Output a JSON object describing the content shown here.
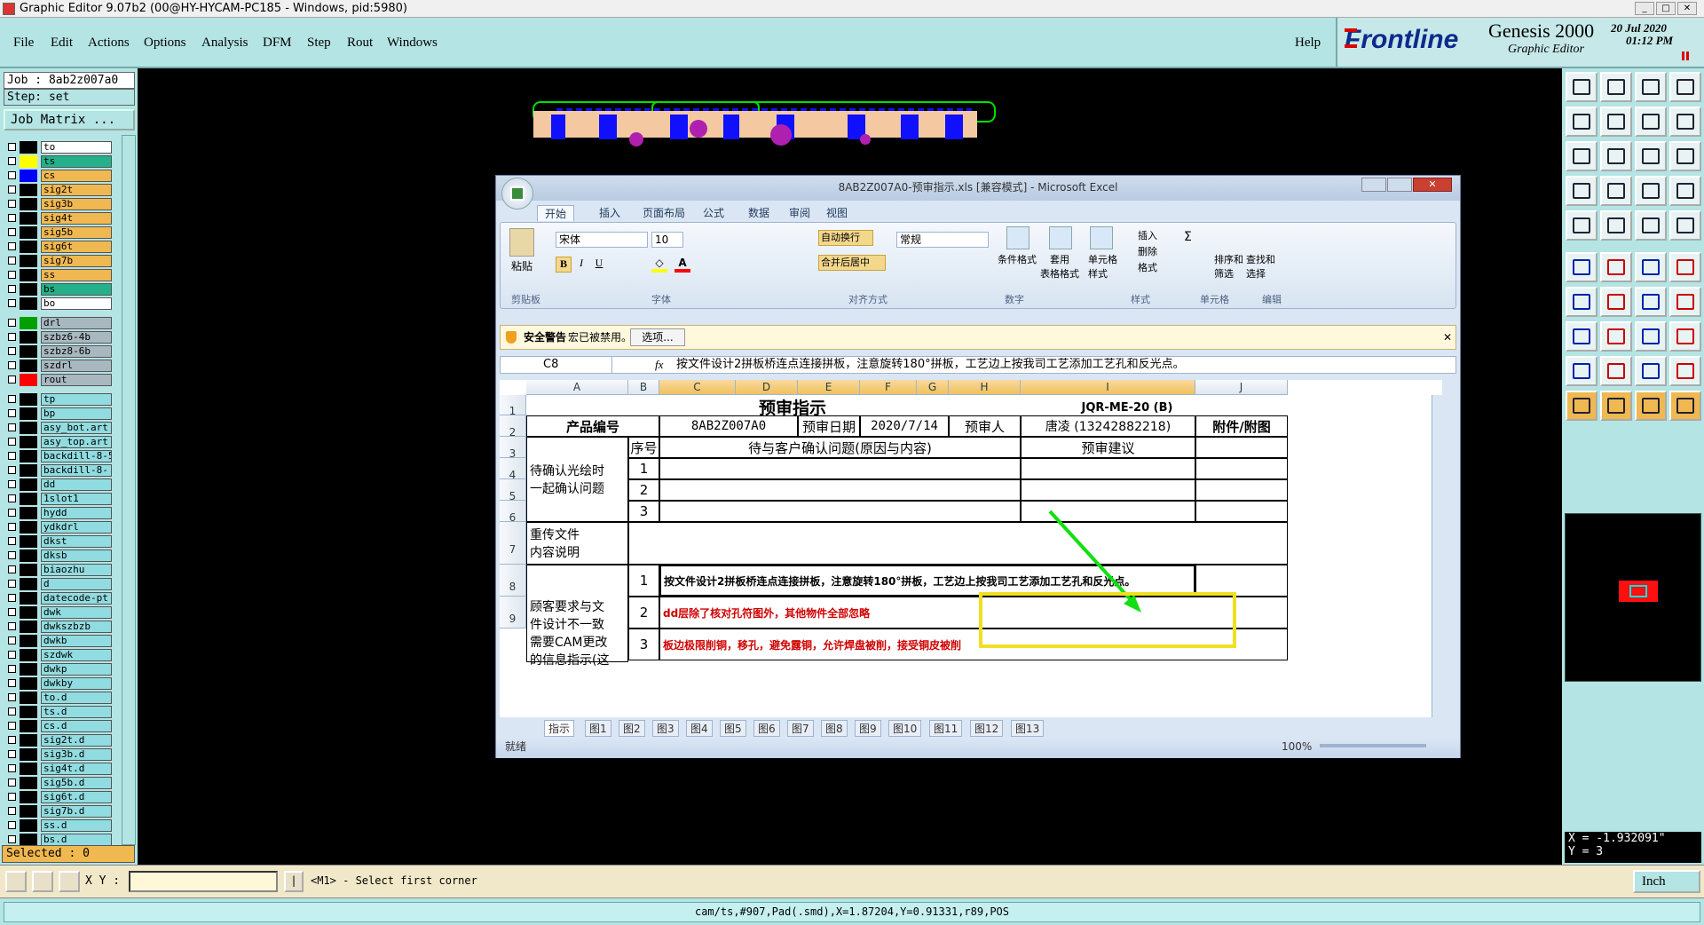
{
  "app": {
    "title": "Graphic Editor 9.07b2 (00@HY-HYCAM-PC185 - Windows, pid:5980)",
    "menu": [
      "File",
      "Edit",
      "Actions",
      "Options",
      "Analysis",
      "DFM",
      "Step",
      "Rout",
      "Windows"
    ],
    "help": "Help",
    "brand": "Frontline",
    "product": "Genesis 2000",
    "product_sub": "Graphic Editor",
    "date": "20 Jul 2020",
    "time": "01:12 PM"
  },
  "left": {
    "job": "Job : 8ab2z007a0",
    "step": "Step: set",
    "job_matrix": "Job Matrix ...",
    "layers": [
      {
        "name": "to",
        "color": "#000000",
        "bg": "#ffffff"
      },
      {
        "name": "ts",
        "color": "#ffff00",
        "bg": "#24b088"
      },
      {
        "name": "cs",
        "color": "#0000ff",
        "bg": "#f0b850"
      },
      {
        "name": "sig2t",
        "color": "#000000",
        "bg": "#f0b850"
      },
      {
        "name": "sig3b",
        "color": "#000000",
        "bg": "#f0b850"
      },
      {
        "name": "sig4t",
        "color": "#000000",
        "bg": "#f0b850"
      },
      {
        "name": "sig5b",
        "color": "#000000",
        "bg": "#f0b850"
      },
      {
        "name": "sig6t",
        "color": "#000000",
        "bg": "#f0b850"
      },
      {
        "name": "sig7b",
        "color": "#000000",
        "bg": "#f0b850"
      },
      {
        "name": "ss",
        "color": "#000000",
        "bg": "#f0b850"
      },
      {
        "name": "bs",
        "color": "#000000",
        "bg": "#24b088"
      },
      {
        "name": "bo",
        "color": "#000000",
        "bg": "#ffffff"
      },
      {
        "name": "drl",
        "color": "#00a000",
        "bg": "#a8b8c0"
      },
      {
        "name": "szbz6-4b",
        "color": "#000000",
        "bg": "#a8b8c0"
      },
      {
        "name": "szbz8-6b",
        "color": "#000000",
        "bg": "#a8b8c0"
      },
      {
        "name": "szdrl",
        "color": "#000000",
        "bg": "#a8b8c0"
      },
      {
        "name": "rout",
        "color": "#ff0000",
        "bg": "#a8b8c0"
      },
      {
        "name": "tp",
        "color": "#000000",
        "bg": "#90dce0"
      },
      {
        "name": "bp",
        "color": "#000000",
        "bg": "#90dce0"
      },
      {
        "name": "asy_bot.art",
        "color": "#000000",
        "bg": "#90dce0"
      },
      {
        "name": "asy_top.art",
        "color": "#000000",
        "bg": "#90dce0"
      },
      {
        "name": "backdill-8-5",
        "color": "#000000",
        "bg": "#90dce0"
      },
      {
        "name": "backdill-8-",
        "color": "#000000",
        "bg": "#90dce0"
      },
      {
        "name": "dd",
        "color": "#000000",
        "bg": "#90dce0"
      },
      {
        "name": "1slot1",
        "color": "#000000",
        "bg": "#90dce0"
      },
      {
        "name": "hydd",
        "color": "#000000",
        "bg": "#90dce0"
      },
      {
        "name": "ydkdrl",
        "color": "#000000",
        "bg": "#90dce0"
      },
      {
        "name": "dkst",
        "color": "#000000",
        "bg": "#90dce0"
      },
      {
        "name": "dksb",
        "color": "#000000",
        "bg": "#90dce0"
      },
      {
        "name": "biaozhu",
        "color": "#000000",
        "bg": "#90dce0"
      },
      {
        "name": "d",
        "color": "#000000",
        "bg": "#90dce0"
      },
      {
        "name": "datecode-pt",
        "color": "#000000",
        "bg": "#90dce0"
      },
      {
        "name": "dwk",
        "color": "#000000",
        "bg": "#90dce0"
      },
      {
        "name": "dwkszbzb",
        "color": "#000000",
        "bg": "#90dce0"
      },
      {
        "name": "dwkb",
        "color": "#000000",
        "bg": "#90dce0"
      },
      {
        "name": "szdwk",
        "color": "#000000",
        "bg": "#90dce0"
      },
      {
        "name": "dwkp",
        "color": "#000000",
        "bg": "#90dce0"
      },
      {
        "name": "dwkby",
        "color": "#000000",
        "bg": "#90dce0"
      },
      {
        "name": "to.d",
        "color": "#000000",
        "bg": "#90dce0"
      },
      {
        "name": "ts.d",
        "color": "#000000",
        "bg": "#90dce0"
      },
      {
        "name": "cs.d",
        "color": "#000000",
        "bg": "#90dce0"
      },
      {
        "name": "sig2t.d",
        "color": "#000000",
        "bg": "#90dce0"
      },
      {
        "name": "sig3b.d",
        "color": "#000000",
        "bg": "#90dce0"
      },
      {
        "name": "sig4t.d",
        "color": "#000000",
        "bg": "#90dce0"
      },
      {
        "name": "sig5b.d",
        "color": "#000000",
        "bg": "#90dce0"
      },
      {
        "name": "sig6t.d",
        "color": "#000000",
        "bg": "#90dce0"
      },
      {
        "name": "sig7b.d",
        "color": "#000000",
        "bg": "#90dce0"
      },
      {
        "name": "ss.d",
        "color": "#000000",
        "bg": "#90dce0"
      },
      {
        "name": "bs.d",
        "color": "#000000",
        "bg": "#90dce0"
      }
    ],
    "selected": "Selected : 0"
  },
  "right": {
    "x": "X = -1.932091\"",
    "y": "Y = 3",
    "unit": "Inch"
  },
  "bottom": {
    "xy_label": "X Y :",
    "prompt": "<M1> - Select first corner",
    "status": "cam/ts,#907,Pad(.smd),X=1.87204,Y=0.91331,r89,POS"
  },
  "excel": {
    "title": "8AB2Z007A0-预审指示.xls [兼容模式] - Microsoft Excel",
    "tabs": [
      "开始",
      "插入",
      "页面布局",
      "公式",
      "数据",
      "审阅",
      "视图"
    ],
    "font_name": "宋体",
    "font_size": "10",
    "number_format": "常规",
    "wrap_text": "自动换行",
    "merge_center": "合并后居中",
    "groups": [
      "剪贴板",
      "字体",
      "对齐方式",
      "数字",
      "样式",
      "单元格",
      "编辑"
    ],
    "paste": "粘贴",
    "cond_format": "条件格式",
    "table_format": "套用\n表格格式",
    "cell_style": "单元格\n样式",
    "insert": "插入",
    "delete": "删除",
    "format": "格式",
    "sort_filter": "排序和\n筛选",
    "find_select": "查找和\n选择",
    "security_title": "安全警告",
    "security_msg": "宏已被禁用。",
    "security_btn": "选项...",
    "namebox": "C8",
    "fx": "fx",
    "formula": "按文件设计2拼板桥连点连接拼板，注意旋转180°拼板，工艺边上按我司工艺添加工艺孔和反光点。",
    "cols": [
      "A",
      "B",
      "C",
      "D",
      "E",
      "F",
      "G",
      "H",
      "I",
      "J"
    ],
    "rows": [
      "1",
      "2",
      "3",
      "4",
      "5",
      "6",
      "7",
      "8",
      "9"
    ],
    "sheet": {
      "title": "预审指示",
      "doc_no": "JQR-ME-20 (B)",
      "prod_label": "产品编号",
      "prod_val": "8AB2Z007A0",
      "date_label": "预审日期",
      "date_val": "2020/7/14",
      "reviewer_label": "预审人",
      "reviewer_val": "唐凌 (13242882218)",
      "attach": "附件/附图",
      "seq": "序号",
      "question": "待与客户确认问题(原因与内容)",
      "suggestion": "预审建议",
      "pending": "待确认光绘时\n一起确认问题",
      "n1": "1",
      "n2": "2",
      "n3": "3",
      "reupload": "重传文件\n内容说明",
      "customer_req": "顾客要求与文\n件设计不一致\n需要CAM更改\n的信息指示(这",
      "r8": "按文件设计2拼板桥连点连接拼板，注意旋转180°拼板，工艺边上按我司工艺添加工艺孔和反光点。",
      "r9": "dd层除了核对孔符图外，其他物件全部忽略",
      "r10": "板边极限削铜，移孔，避免露铜，允许焊盘被削，接受铜皮被削"
    },
    "sheet_tabs": [
      "指示",
      "图1",
      "图2",
      "图3",
      "图4",
      "图5",
      "图6",
      "图7",
      "图8",
      "图9",
      "图10",
      "图11",
      "图12",
      "图13"
    ],
    "status": "就绪",
    "zoom": "100%"
  }
}
